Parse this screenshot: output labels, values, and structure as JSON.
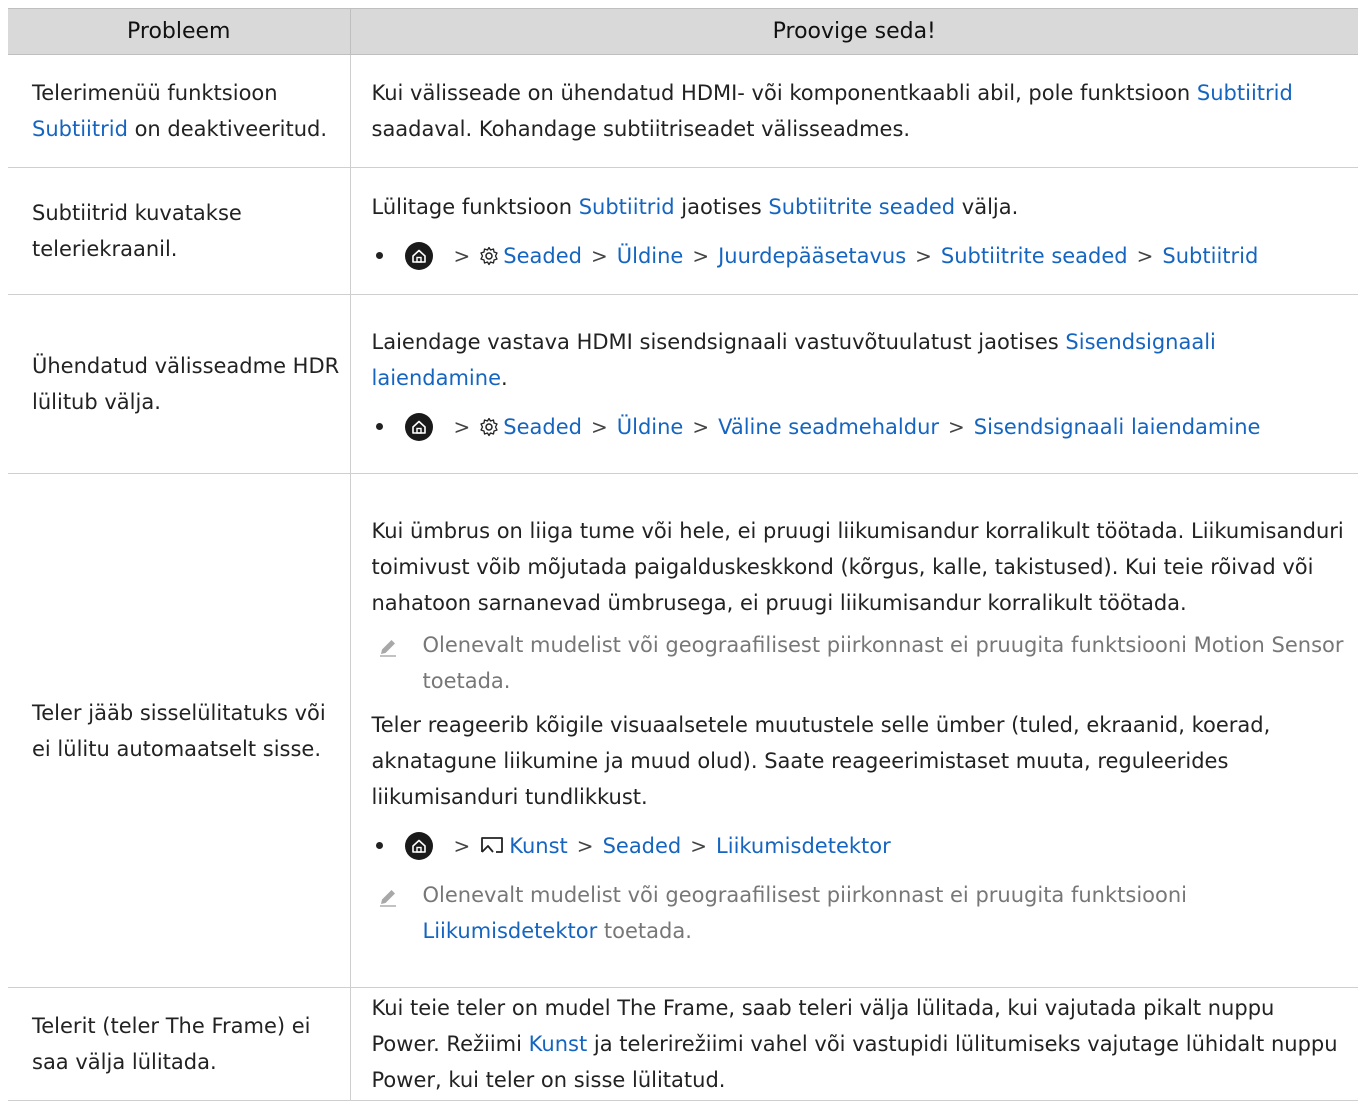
{
  "header": {
    "col1": "Probleem",
    "col2": "Proovige seda!"
  },
  "rows": {
    "r1": {
      "problem_a": "Telerimenüü funktsioon ",
      "problem_link": "Subtiitrid",
      "problem_b": " on deaktiveeritud.",
      "sol_a": "Kui välisseade on ühendatud HDMI- või komponentkaabli abil, pole funktsioon ",
      "sol_link": "Subtiitrid",
      "sol_b": " saadaval. Kohandage subtiitriseadet välisseadmes."
    },
    "r2": {
      "problem": "Subtiitrid kuvatakse teleriekraanil.",
      "sol_a": "Lülitage funktsioon ",
      "sol_link1": "Subtiitrid",
      "sol_b": " jaotises ",
      "sol_link2": "Subtiitrite seaded",
      "sol_c": " välja.",
      "path": [
        "Seaded",
        "Üldine",
        "Juurdepääsetavus",
        "Subtiitrite seaded",
        "Subtiitrid"
      ]
    },
    "r3": {
      "problem": "Ühendatud välisseadme HDR lülitub välja.",
      "sol_a": "Laiendage vastava HDMI sisendsignaali vastuvõtuulatust jaotises ",
      "sol_link": "Sisendsignaali laiendamine",
      "sol_b": ".",
      "path": [
        "Seaded",
        "Üldine",
        "Väline seadmehaldur",
        "Sisendsignaali laiendamine"
      ]
    },
    "r4": {
      "problem": "Teler jääb sisselülitatuks või ei lülitu automaatselt sisse.",
      "para1": "Kui ümbrus on liiga tume või hele, ei pruugi liikumisandur korralikult töötada. Liikumisanduri toimivust võib mõjutada paigalduskeskkond (kõrgus, kalle, takistused). Kui teie rõivad või nahatoon sarnanevad ümbrusega, ei pruugi liikumisandur korralikult töötada.",
      "note1": "Olenevalt mudelist või geograafilisest piirkonnast ei pruugita funktsiooni Motion Sensor toetada.",
      "para2": "Teler reageerib kõigile visuaalsetele muutustele selle ümber (tuled, ekraanid, koerad, aknatagune liikumine ja muud olud). Saate reageerimistaset muuta, reguleerides liikumisanduri tundlikkust.",
      "path": [
        "Kunst",
        "Seaded",
        "Liikumisdetektor"
      ],
      "note2_a": "Olenevalt mudelist või geograafilisest piirkonnast ei pruugita funktsiooni ",
      "note2_link": "Liikumisdetektor",
      "note2_b": " toetada."
    },
    "r5": {
      "problem": "Telerit (teler The Frame) ei saa välja lülitada.",
      "sol_a": "Kui teie teler on mudel The Frame, saab teleri välja lülitada, kui vajutada pikalt nuppu Power. Režiimi ",
      "sol_link": "Kunst",
      "sol_b": " ja telerirežiimi vahel või vastupidi lülitumiseks vajutage lühidalt nuppu Power, kui teler on sisse lülitatud."
    }
  },
  "colors": {
    "link": "#1565c0",
    "header_bg": "#d9d9d9",
    "note_text": "#777777"
  }
}
